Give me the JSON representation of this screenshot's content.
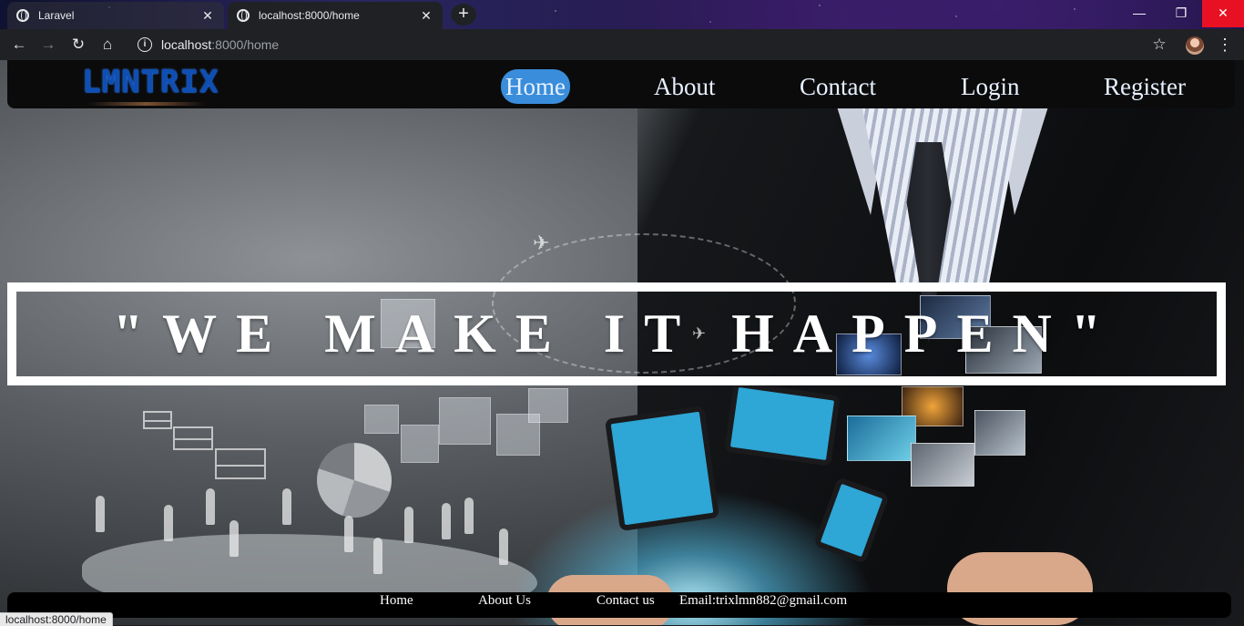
{
  "browser": {
    "tabs": [
      {
        "title": "Laravel",
        "active": false
      },
      {
        "title": "localhost:8000/home",
        "active": true
      }
    ],
    "new_tab_symbol": "+",
    "address": {
      "host": "localhost",
      "path": ":8000/home"
    },
    "status_url": "localhost:8000/home",
    "window_controls": [
      "minimize",
      "restore",
      "close"
    ]
  },
  "site": {
    "logo_text": "LMNTRIX",
    "nav": [
      {
        "label": "Home",
        "active": true
      },
      {
        "label": "About",
        "active": false
      },
      {
        "label": "Contact",
        "active": false
      },
      {
        "label": "Login",
        "active": false
      },
      {
        "label": "Register",
        "active": false
      }
    ],
    "hero": {
      "slogan": "\"WE MAKE IT HAPPEN\""
    },
    "footer": {
      "links": [
        "Home",
        "About Us",
        "Contact us"
      ],
      "email": "Email:trixlmn882@gmail.com"
    }
  },
  "colors": {
    "nav_active_bg": "#3a8ddb",
    "logo_blue": "#0f4fb4",
    "chrome_dark": "#202124",
    "close_red": "#e81123"
  }
}
